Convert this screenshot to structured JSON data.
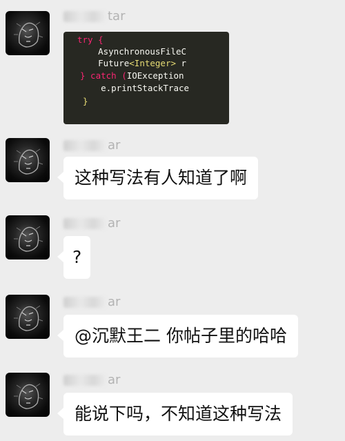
{
  "messages": [
    {
      "sender_suffix": "tar",
      "type": "code",
      "code_lines": {
        "l1": "try {",
        "l2": "    AsynchronousFileC",
        "l3a": "    Future",
        "l3b": "<Integer>",
        "l3c": " r",
        "l4a": "} catch (",
        "l4b": "IOException",
        "l5": "    e.printStackTrace",
        "l6": "}"
      }
    },
    {
      "sender_suffix": "ar",
      "type": "text",
      "text": "这种写法有人知道了啊"
    },
    {
      "sender_suffix": "ar",
      "type": "text",
      "text": "?"
    },
    {
      "sender_suffix": "ar",
      "type": "text",
      "text": "@沉默王二 你帖子里的哈哈"
    },
    {
      "sender_suffix": "ar",
      "type": "text",
      "text": "能说下吗，不知道这种写法"
    }
  ]
}
